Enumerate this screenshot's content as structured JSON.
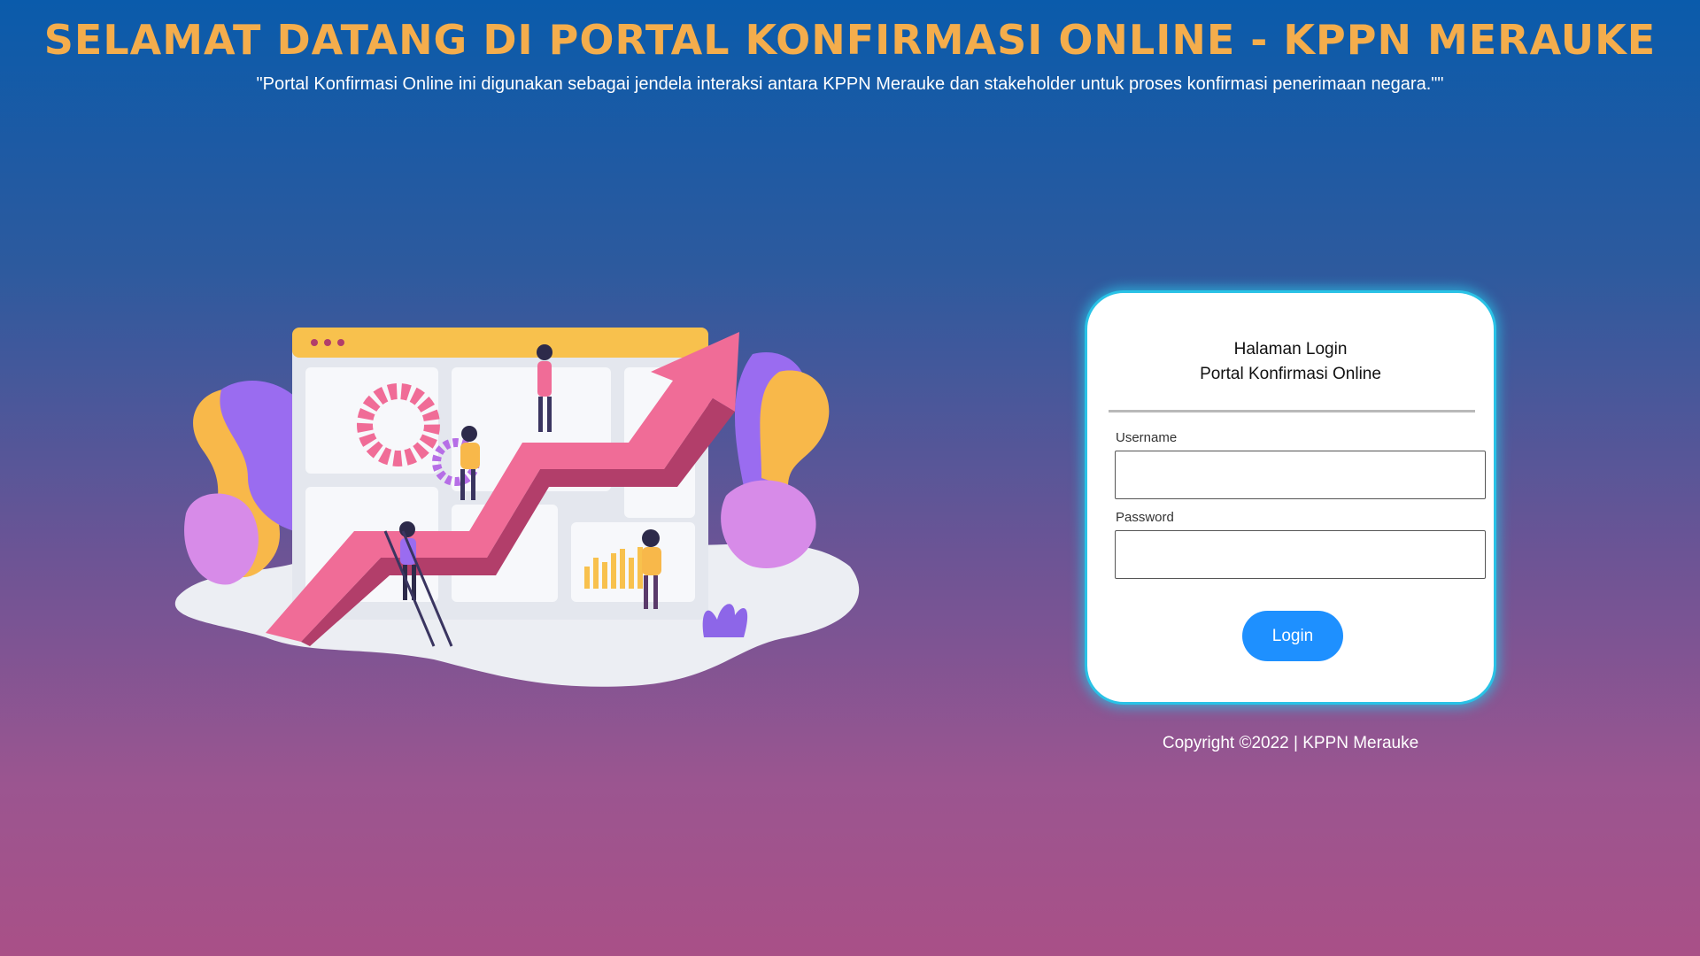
{
  "header": {
    "title": "SELAMAT DATANG DI PORTAL KONFIRMASI ONLINE - KPPN MERAUKE",
    "subtitle": "\"Portal Konfirmasi Online ini digunakan sebagai jendela interaksi antara KPPN Merauke dan stakeholder untuk proses konfirmasi penerimaan negara.\"\""
  },
  "login": {
    "heading_line1": "Halaman Login",
    "heading_line2": "Portal Konfirmasi Online",
    "username_label": "Username",
    "username_value": "",
    "password_label": "Password",
    "password_value": "",
    "button_label": "Login"
  },
  "footer": {
    "copyright": "Copyright ©2022 | KPPN Merauke"
  },
  "illustration": {
    "icon": "dashboard-growth-illustration"
  },
  "colors": {
    "title": "#f4ad4c",
    "card_border": "#29c2e6",
    "button": "#1e90ff",
    "bg_top": "#0a5bab",
    "bg_bottom": "#a95087"
  }
}
